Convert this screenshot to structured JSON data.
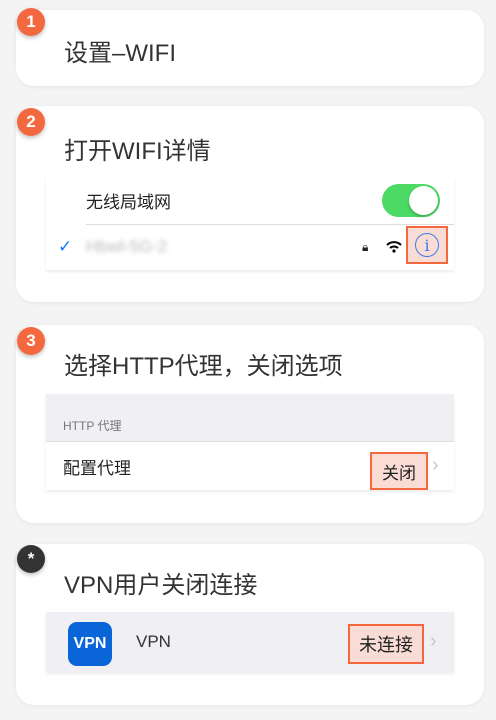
{
  "steps": [
    {
      "badge": "1",
      "title": "设置–WIFI"
    },
    {
      "badge": "2",
      "title": "打开WIFI详情"
    },
    {
      "badge": "3",
      "title": "选择HTTP代理，关闭选项"
    },
    {
      "badge": "*",
      "title": "VPN用户关闭连接"
    }
  ],
  "wifi": {
    "label": "无线局域网",
    "toggle_on": true,
    "network": "Hbwl-5G-2",
    "info": "i"
  },
  "proxy": {
    "header": "HTTP 代理",
    "label": "配置代理",
    "value": "关闭"
  },
  "vpn": {
    "icon": "VPN",
    "label": "VPN",
    "status": "未连接"
  },
  "colors": {
    "accent": "#f4683f",
    "toggle": "#4cd964",
    "vpn_icon": "#0a66d8"
  }
}
